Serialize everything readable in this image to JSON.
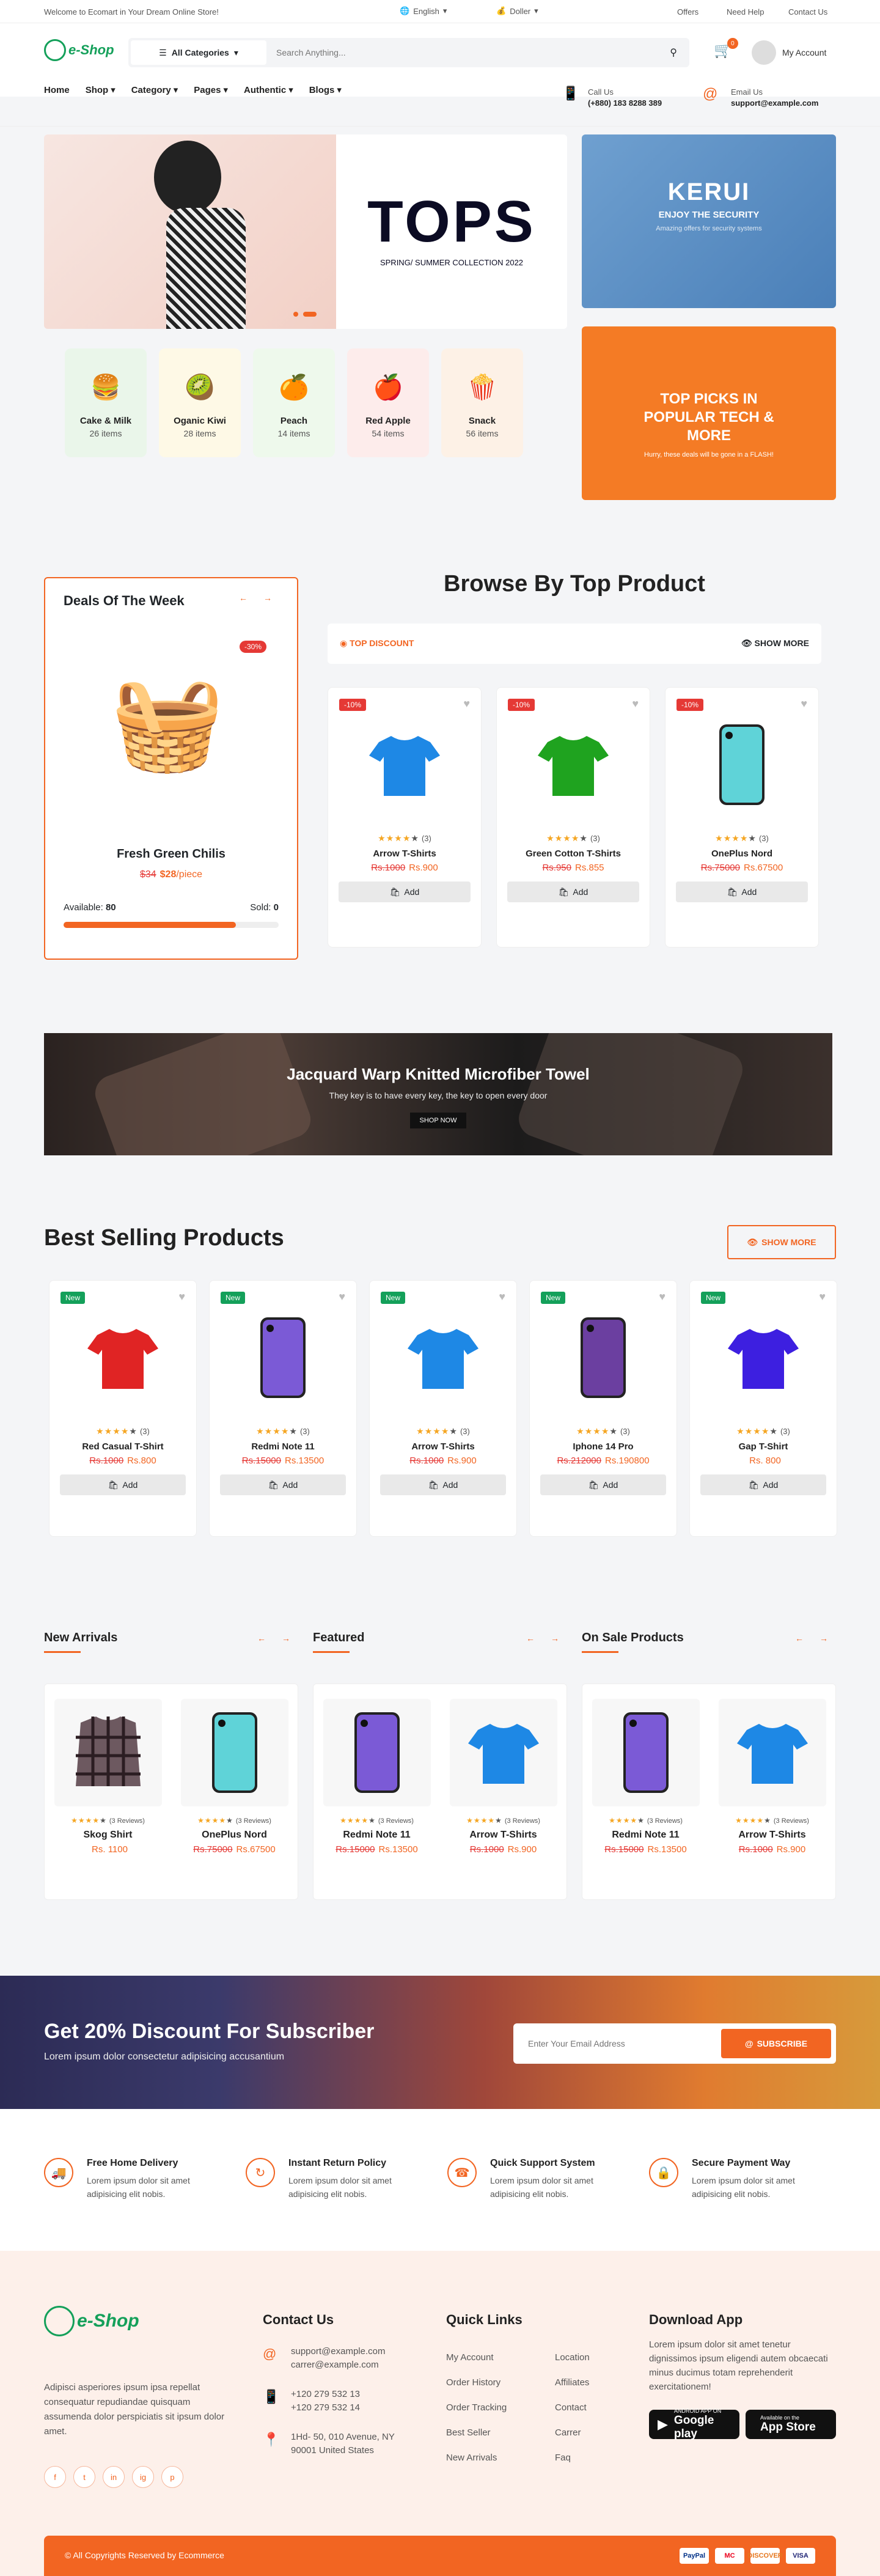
{
  "topbar": {
    "welcome": "Welcome to Ecomart in Your Dream Online Store!",
    "language": "English",
    "currency": "Doller",
    "links": [
      "Offers",
      "Need Help",
      "Contact Us"
    ]
  },
  "header": {
    "logo": "e-Shop",
    "cart_count": "0",
    "search_category": "All Categories",
    "search_placeholder": "Search Anything...",
    "account": "My Account",
    "call_label": "Call Us",
    "call_value": "(+880) 183 8288 389",
    "email_label": "Email Us",
    "email_value": "support@example.com"
  },
  "nav": [
    "Home",
    "Shop",
    "Category",
    "Pages",
    "Authentic",
    "Blogs"
  ],
  "hero": {
    "headline": "TOPS",
    "sub": "SPRING/ SUMMER COLLECTION 2022"
  },
  "promo1": {
    "title": "KERUI",
    "sub": "ENJOY THE SECURITY",
    "small": "Amazing offers for security systems"
  },
  "promo2": {
    "title": "TOP PICKS IN POPULAR TECH & MORE",
    "small": "Hurry, these deals will be gone in a FLASH!"
  },
  "categories": [
    {
      "name": "Cake & Milk",
      "count": "26 items",
      "icon": "🍔",
      "bg": "#eaf6ea"
    },
    {
      "name": "Oganic Kiwi",
      "count": "28 items",
      "icon": "🥝",
      "bg": "#fef9e6"
    },
    {
      "name": "Peach",
      "count": "14 items",
      "icon": "🍊",
      "bg": "#eef9ec"
    },
    {
      "name": "Red Apple",
      "count": "54 items",
      "icon": "🍎",
      "bg": "#fdeceb"
    },
    {
      "name": "Snack",
      "count": "56 items",
      "icon": "🍿",
      "bg": "#fdf1e6"
    }
  ],
  "deals": {
    "title": "Deals Of The Week",
    "badge": "-30%",
    "name": "Fresh Green Chilis",
    "old": "$34",
    "new": "$28",
    "unit": "/piece",
    "available_label": "Available:",
    "available": "80",
    "sold_label": "Sold:",
    "sold": "0",
    "progress": 0.8
  },
  "browse": {
    "title": "Browse By Top Product",
    "tab": "TOP DISCOUNT",
    "show_more": "SHOW MORE",
    "products": [
      {
        "badge": "-10%",
        "name": "Arrow T-Shirts",
        "old": "Rs.1000",
        "new": "Rs.900",
        "reviews": "(3)",
        "img": "tshirt",
        "color": "#1e88e5"
      },
      {
        "badge": "-10%",
        "name": "Green Cotton T-Shirts",
        "old": "Rs.950",
        "new": "Rs.855",
        "reviews": "(3)",
        "img": "tshirt",
        "color": "#1fa31f"
      },
      {
        "badge": "-10%",
        "name": "OnePlus Nord",
        "old": "Rs.75000",
        "new": "Rs.67500",
        "reviews": "(3)",
        "img": "phone",
        "color": "#5fd3d8"
      }
    ]
  },
  "add_label": "Add",
  "banner": {
    "title": "Jacquard Warp Knitted Microfiber Towel",
    "sub": "They key is to have every key, the key to open every door",
    "btn": "SHOP NOW"
  },
  "best": {
    "title": "Best Selling Products",
    "show_more": "SHOW MORE",
    "products": [
      {
        "badge": "New",
        "name": "Red Casual T-Shirt",
        "old": "Rs.1000",
        "new": "Rs.800",
        "reviews": "(3)",
        "img": "tshirt",
        "color": "#e02424"
      },
      {
        "badge": "New",
        "name": "Redmi Note 11",
        "old": "Rs.15000",
        "new": "Rs.13500",
        "reviews": "(3)",
        "img": "phone",
        "color": "#7b5ad6"
      },
      {
        "badge": "New",
        "name": "Arrow T-Shirts",
        "old": "Rs.1000",
        "new": "Rs.900",
        "reviews": "(3)",
        "img": "tshirt",
        "color": "#1e88e5"
      },
      {
        "badge": "New",
        "name": "Iphone 14 Pro",
        "old": "Rs.212000",
        "new": "Rs.190800",
        "reviews": "(3)",
        "img": "phone",
        "color": "#6b3fa0"
      },
      {
        "badge": "New",
        "name": "Gap T-Shirt",
        "old": "",
        "new": "Rs. 800",
        "reviews": "(3)",
        "img": "tshirt",
        "color": "#3d1fe0"
      }
    ]
  },
  "lists": [
    {
      "title": "New Arrivals",
      "items": [
        {
          "name": "Skog Shirt",
          "old": "",
          "new": "Rs. 1100",
          "reviews": "(3 Reviews)",
          "img": "shirt",
          "color": "#6d5960"
        },
        {
          "name": "OnePlus Nord",
          "old": "Rs.75000",
          "new": "Rs.67500",
          "reviews": "(3 Reviews)",
          "img": "phone",
          "color": "#5fd3d8"
        }
      ]
    },
    {
      "title": "Featured",
      "items": [
        {
          "name": "Redmi Note 11",
          "old": "Rs.15000",
          "new": "Rs.13500",
          "reviews": "(3 Reviews)",
          "img": "phone",
          "color": "#7b5ad6"
        },
        {
          "name": "Arrow T-Shirts",
          "old": "Rs.1000",
          "new": "Rs.900",
          "reviews": "(3 Reviews)",
          "img": "tshirt",
          "color": "#1e88e5"
        }
      ]
    },
    {
      "title": "On Sale Products",
      "items": [
        {
          "name": "Redmi Note 11",
          "old": "Rs.15000",
          "new": "Rs.13500",
          "reviews": "(3 Reviews)",
          "img": "phone",
          "color": "#7b5ad6"
        },
        {
          "name": "Arrow T-Shirts",
          "old": "Rs.1000",
          "new": "Rs.900",
          "reviews": "(3 Reviews)",
          "img": "tshirt",
          "color": "#1e88e5"
        }
      ]
    }
  ],
  "subscribe": {
    "title": "Get 20% Discount For Subscriber",
    "sub": "Lorem ipsum dolor consectetur adipisicing accusantium",
    "placeholder": "Enter Your Email Address",
    "btn": "SUBSCRIBE"
  },
  "features": [
    {
      "title": "Free Home Delivery",
      "text": "Lorem ipsum dolor sit amet adipisicing elit nobis.",
      "icon": "🚚"
    },
    {
      "title": "Instant Return Policy",
      "text": "Lorem ipsum dolor sit amet adipisicing elit nobis.",
      "icon": "↻"
    },
    {
      "title": "Quick Support System",
      "text": "Lorem ipsum dolor sit amet adipisicing elit nobis.",
      "icon": "☎"
    },
    {
      "title": "Secure Payment Way",
      "text": "Lorem ipsum dolor sit amet adipisicing elit nobis.",
      "icon": "🔒"
    }
  ],
  "footer": {
    "about": "Adipisci asperiores ipsum ipsa repellat consequatur repudiandae quisquam assumenda dolor perspiciatis sit ipsum dolor amet.",
    "social": [
      "f",
      "t",
      "in",
      "ig",
      "p"
    ],
    "contact_title": "Contact Us",
    "emails": [
      "support@example.com",
      "carrer@example.com"
    ],
    "phones": [
      "+120 279 532 13",
      "+120 279 532 14"
    ],
    "address": "1Hd- 50, 010 Avenue, NY 90001 United States",
    "quick_title": "Quick Links",
    "links1": [
      "My Account",
      "Order History",
      "Order Tracking",
      "Best Seller",
      "New Arrivals"
    ],
    "links2": [
      "Location",
      "Affiliates",
      "Contact",
      "Carrer",
      "Faq"
    ],
    "app_title": "Download App",
    "app_text": "Lorem ipsum dolor sit amet tenetur dignissimos ipsum eligendi autem obcaecati minus ducimus totam reprehenderit exercitationem!",
    "gp_small": "ANDROID APP ON",
    "gp_big": "Google play",
    "as_small": "Available on the",
    "as_big": "App Store",
    "copyright": "© All Copyrights Reserved by Ecommerce",
    "payments": [
      "PayPal",
      "MC",
      "DISCOVER",
      "VISA"
    ]
  },
  "colors": {
    "accent": "#f26522",
    "green": "#14a05a"
  }
}
